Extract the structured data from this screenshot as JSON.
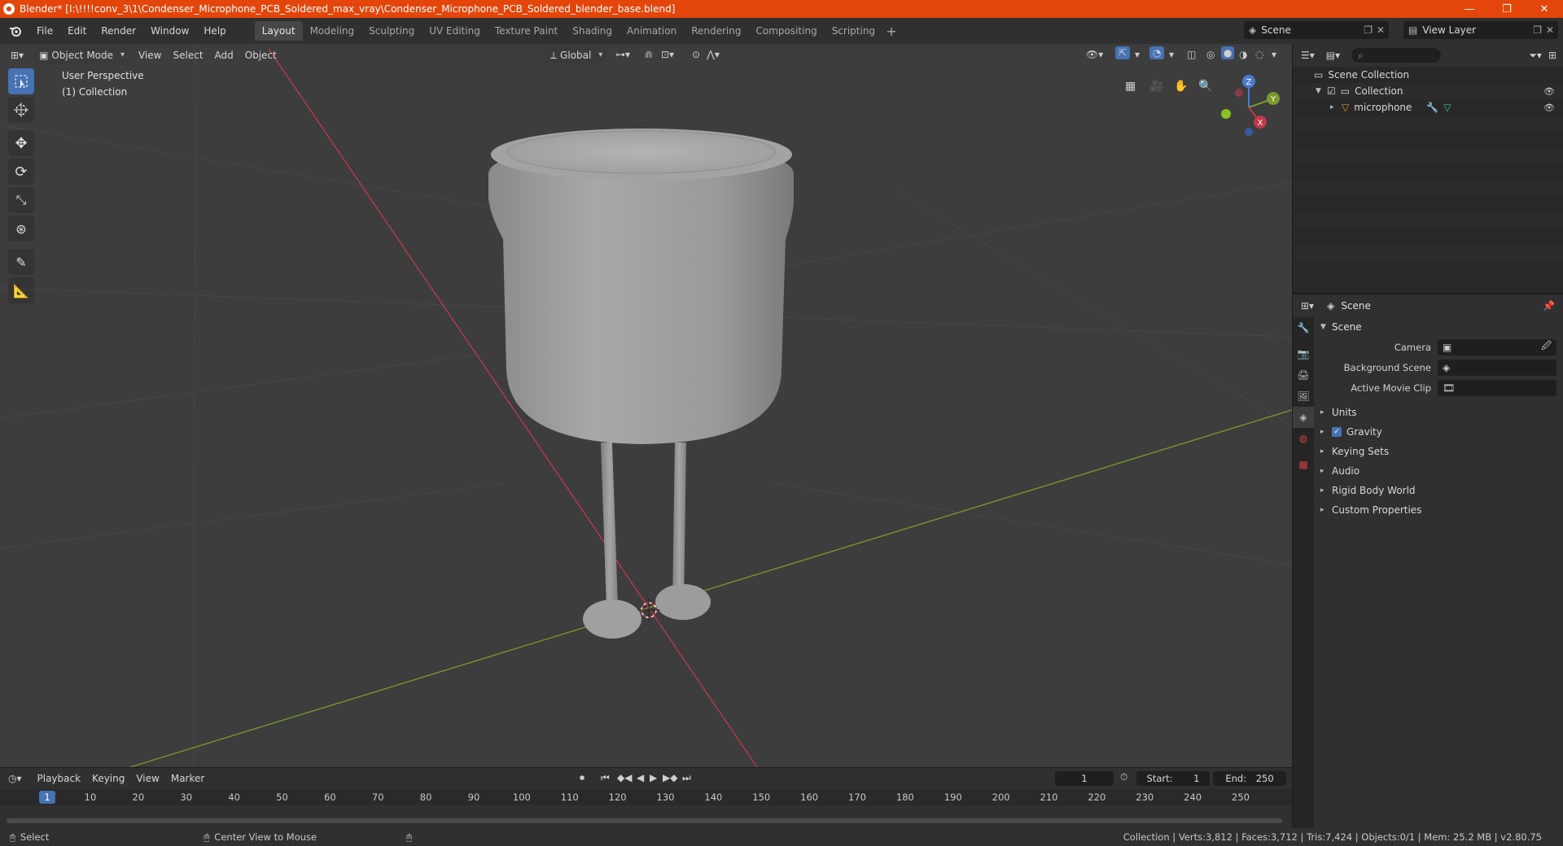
{
  "window": {
    "title": "Blender* [I:\\!!!!conv_3\\1\\Condenser_Microphone_PCB_Soldered_max_vray\\Condenser_Microphone_PCB_Soldered_blender_base.blend]",
    "minimize": "—",
    "maximize": "❐",
    "close": "✕"
  },
  "menu": [
    "File",
    "Edit",
    "Render",
    "Window",
    "Help"
  ],
  "workspaces": [
    "Layout",
    "Modeling",
    "Sculpting",
    "UV Editing",
    "Texture Paint",
    "Shading",
    "Animation",
    "Rendering",
    "Compositing",
    "Scripting"
  ],
  "workspace_add": "+",
  "scene_selector": "Scene",
  "view_layer_selector": "View Layer",
  "viewport": {
    "mode": "Object Mode",
    "menus": [
      "View",
      "Select",
      "Add",
      "Object"
    ],
    "transform_orientation": "Global",
    "perspective_label": "User Perspective",
    "collection_label": "(1) Collection",
    "gizmo": {
      "z": "Z",
      "y": "Y",
      "x": "X"
    }
  },
  "outliner": {
    "root": "Scene Collection",
    "collection": "Collection",
    "object": "microphone"
  },
  "properties": {
    "header": "Scene",
    "section": "Scene",
    "camera_label": "Camera",
    "background_scene_label": "Background Scene",
    "active_movie_clip_label": "Active Movie Clip",
    "subsections": [
      "Units",
      "Gravity",
      "Keying Sets",
      "Audio",
      "Rigid Body World",
      "Custom Properties"
    ]
  },
  "timeline": {
    "menus": [
      "Playback",
      "Keying",
      "View",
      "Marker"
    ],
    "current_frame": "1",
    "start_label": "Start:",
    "start": "1",
    "end_label": "End:",
    "end": "250",
    "ruler": [
      "1",
      "10",
      "20",
      "30",
      "40",
      "50",
      "60",
      "70",
      "80",
      "90",
      "100",
      "110",
      "120",
      "130",
      "140",
      "150",
      "160",
      "170",
      "180",
      "190",
      "200",
      "210",
      "220",
      "230",
      "240",
      "250"
    ]
  },
  "statusbar": {
    "select": "Select",
    "center_view": "Center View to Mouse",
    "stats": "Collection | Verts:3,812 | Faces:3,712 | Tris:7,424 | Objects:0/1 | Mem: 25.2 MB | v2.80.75"
  },
  "colors": {
    "accent": "#4772b3",
    "titlebar": "#e4450a",
    "axis_x": "#c0394b",
    "axis_y": "#7a9a2a"
  }
}
